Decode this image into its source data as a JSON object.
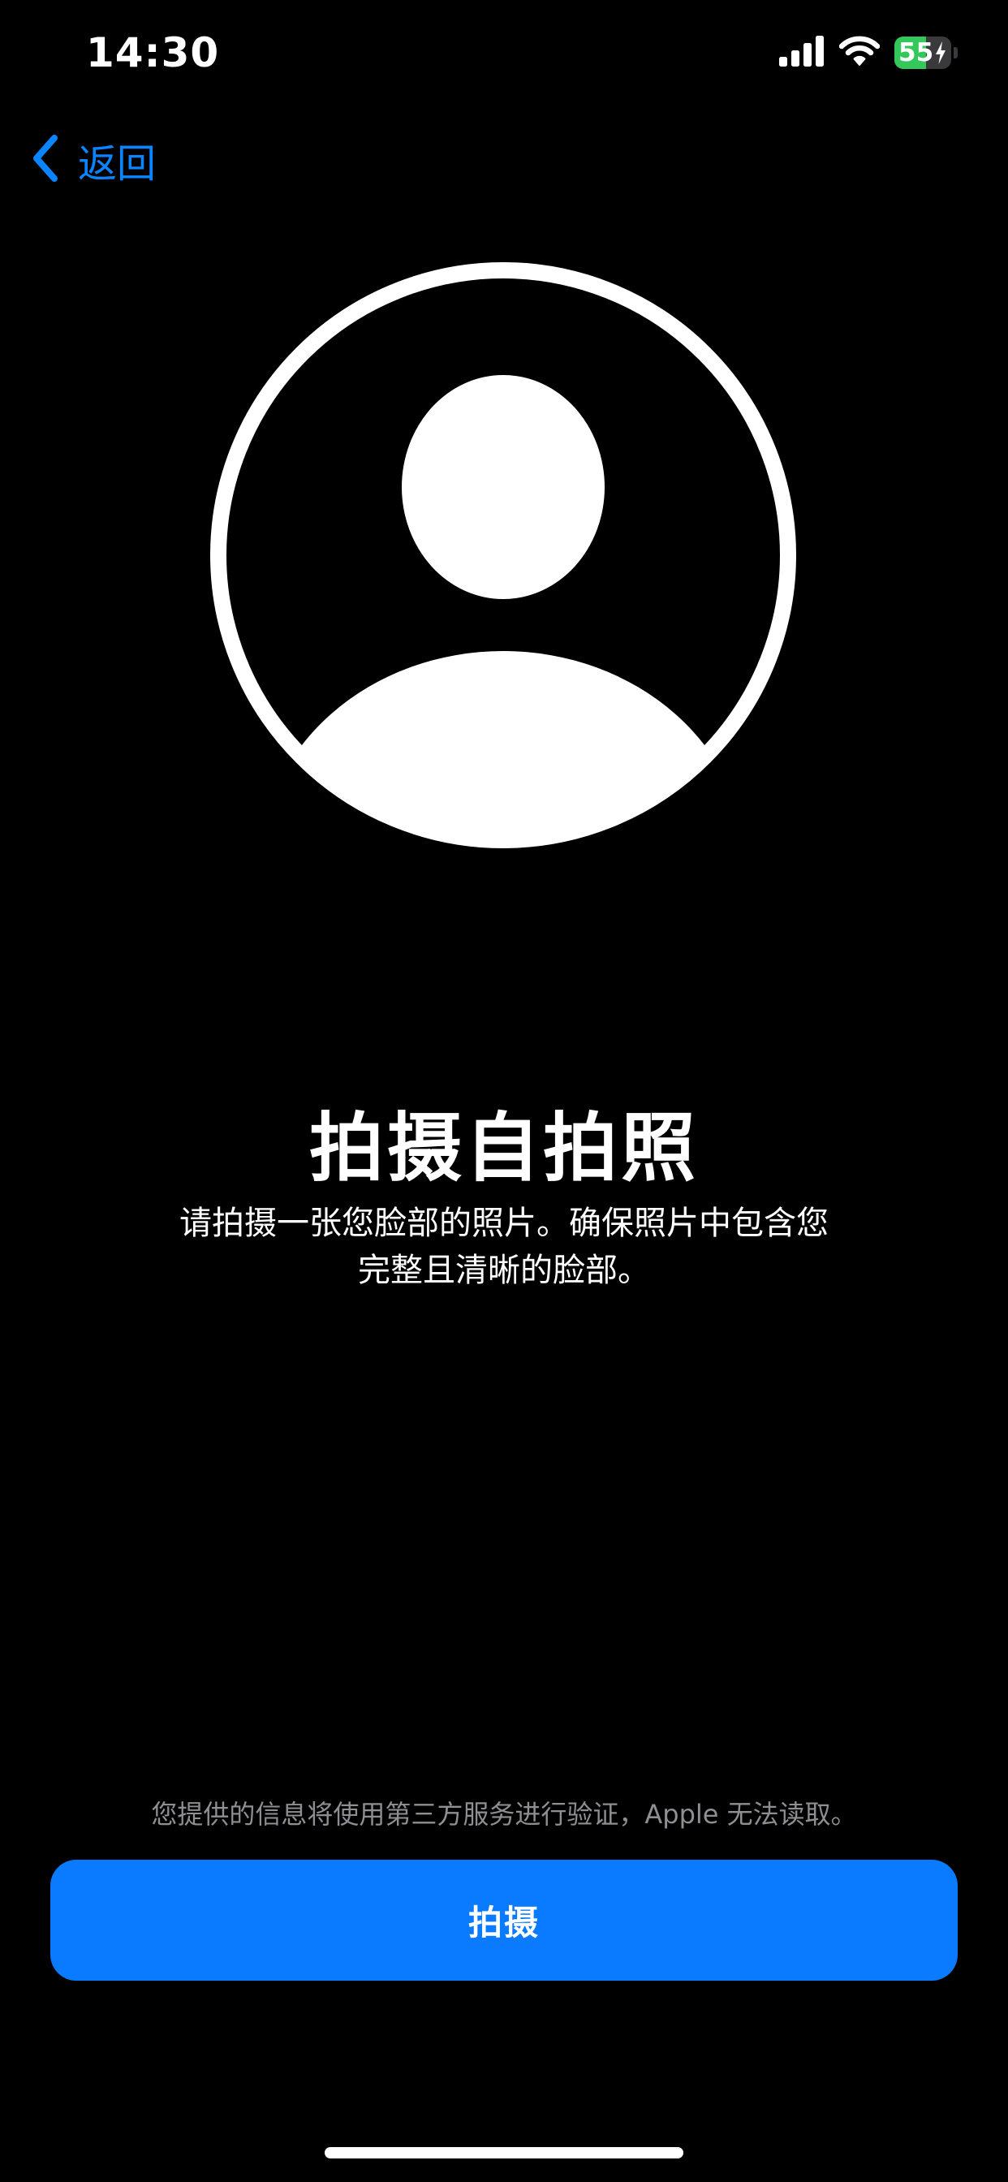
{
  "status_bar": {
    "time": "14:30",
    "battery_level": "55",
    "battery_fraction": 0.55,
    "icons": [
      "cellular-signal-icon",
      "wifi-icon",
      "battery-charging-icon"
    ]
  },
  "nav": {
    "back_label": "返回",
    "back_icon": "chevron-left-icon"
  },
  "avatar": {
    "icon": "person-circle-icon"
  },
  "content": {
    "title": "拍摄自拍照",
    "subtitle_line1": "请拍摄一张您脸部的照片。确保照片中包含您",
    "subtitle_line2": "完整且清晰的脸部。"
  },
  "footer": {
    "note": "您提供的信息将使用第三方服务进行验证，Apple 无法读取。",
    "button_label": "拍摄"
  },
  "colors": {
    "background": "#000000",
    "accent": "#0a84ff",
    "button": "#0a7aff",
    "battery": "#34c759",
    "secondary_text": "#8e8e93"
  }
}
